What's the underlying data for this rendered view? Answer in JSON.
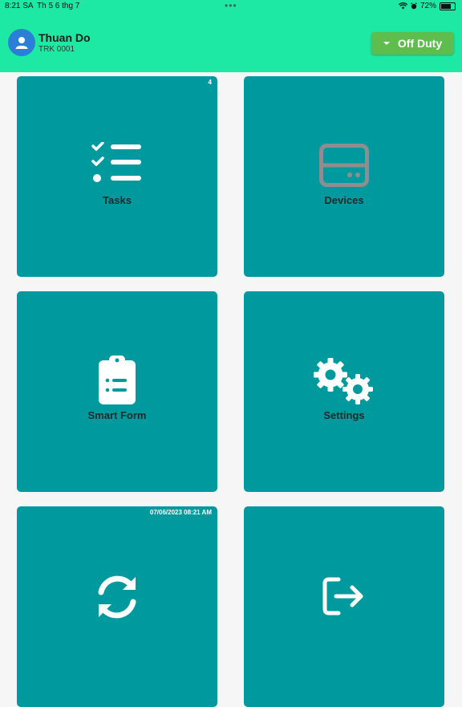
{
  "status_bar": {
    "time": "8:21 SA",
    "date": "Th 5 6 thg 7",
    "battery": "72%",
    "battery_level": 0.72
  },
  "header": {
    "user_name": "Thuan Do",
    "user_code": "TRK 0001",
    "duty_status": "Off Duty"
  },
  "tiles": [
    {
      "label": "Tasks",
      "badge": "4",
      "icon": "task-list-icon"
    },
    {
      "label": "Devices",
      "badge": "",
      "icon": "device-icon"
    },
    {
      "label": "Smart Form",
      "badge": "",
      "icon": "clipboard-icon"
    },
    {
      "label": "Settings",
      "badge": "",
      "icon": "gears-icon"
    },
    {
      "label": "",
      "badge": "07/06/2023 08:21 AM",
      "icon": "sync-icon"
    },
    {
      "label": "",
      "badge": "",
      "icon": "logout-icon"
    }
  ],
  "colors": {
    "header": "#1de9a4",
    "tile": "#009a9e",
    "duty_button": "#5fbd4e",
    "avatar": "#2b7fd6"
  }
}
